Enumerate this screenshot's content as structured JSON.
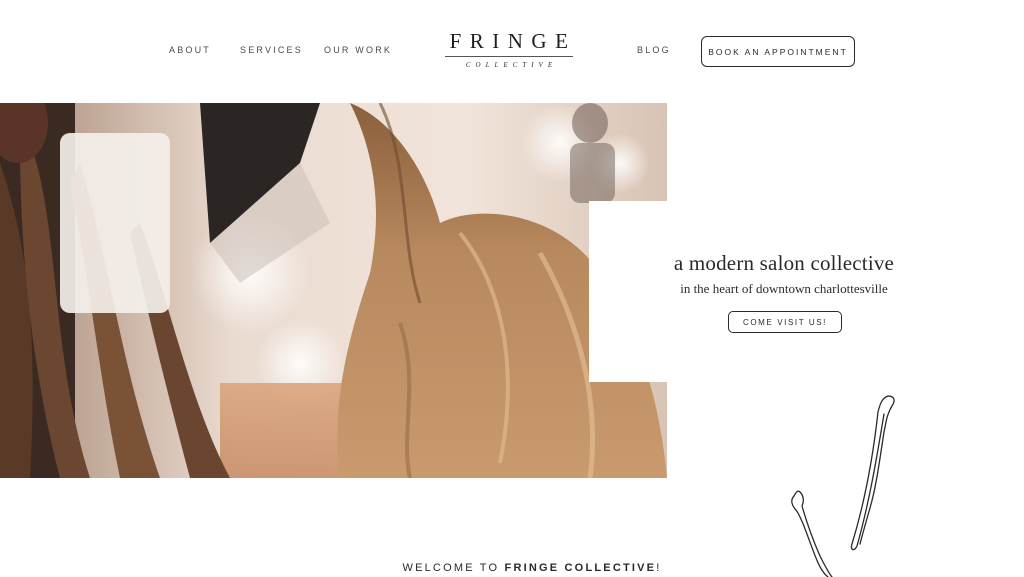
{
  "nav": {
    "about": "ABOUT",
    "services": "SERVICES",
    "our_work": "OUR WORK",
    "blog": "BLOG",
    "book": "BOOK AN APPOINTMENT"
  },
  "logo": {
    "main": "FRINGE",
    "sub": "COLLECTIVE"
  },
  "hero": {
    "title": "a modern salon collective",
    "subtitle": "in the heart of downtown charlottesville",
    "cta": "COME VISIT US!"
  },
  "welcome": {
    "prefix": "WELCOME TO ",
    "brand": "FRINGE COLLECTIVE",
    "suffix": "!"
  },
  "colors": {
    "text": "#2a2a2a",
    "background": "#ffffff",
    "hair": "#b8895e"
  }
}
